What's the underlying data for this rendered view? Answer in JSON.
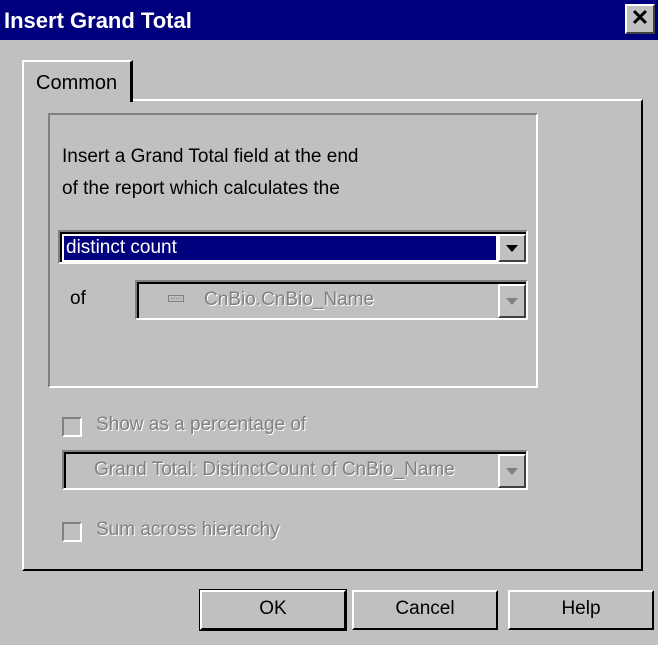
{
  "window": {
    "title": "Insert Grand Total"
  },
  "tabs": [
    {
      "label": "Common"
    }
  ],
  "description": {
    "line1": "Insert a Grand Total field at the end",
    "line2": "of the report which calculates the"
  },
  "calc_select": {
    "value": "distinct count"
  },
  "of_field": {
    "label": "of",
    "value": "CnBio.CnBio_Name"
  },
  "percentage": {
    "label": "Show as a percentage of",
    "checked": false,
    "value": "Grand Total: DistinctCount of CnBio_Name"
  },
  "hierarchy": {
    "label": "Sum across hierarchy",
    "checked": false
  },
  "buttons": {
    "ok": "OK",
    "cancel": "Cancel",
    "help": "Help"
  },
  "colors": {
    "titlebar": "#00007f",
    "face": "#c0c0c0",
    "selection": "#00007f",
    "disabled_text": "#808080"
  }
}
